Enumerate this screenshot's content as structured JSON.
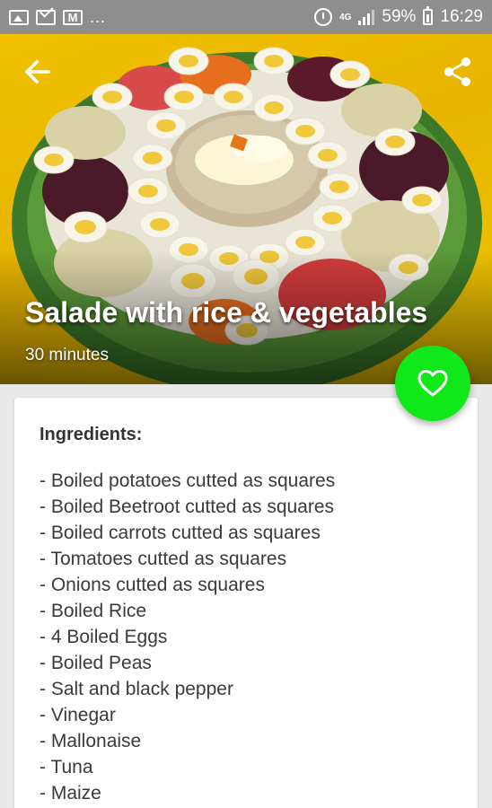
{
  "status_bar": {
    "notification_icons": [
      "image-icon",
      "mail-icon",
      "gmail-icon"
    ],
    "overflow": "...",
    "network": "4G",
    "battery": "59%",
    "time": "16:29"
  },
  "toolbar": {
    "back_icon": "arrow-left-icon",
    "share_icon": "share-icon"
  },
  "recipe": {
    "title": "Salade with rice & vegetables",
    "time": "30 minutes",
    "favorite_icon": "heart-outline-icon",
    "favorite_color": "#11e81a"
  },
  "ingredients": {
    "title": "Ingredients:",
    "items": [
      "- Boiled potatoes cutted as squares",
      "- Boiled Beetroot cutted as squares",
      "- Boiled carrots cutted as squares",
      "- Tomatoes cutted as squares",
      "- Onions cutted as squares",
      "- Boiled Rice",
      "- 4 Boiled Eggs",
      "- Boiled Peas",
      "- Salt and black pepper",
      "- Vinegar",
      "- Mallonaise",
      "- Tuna",
      "- Maize"
    ]
  }
}
